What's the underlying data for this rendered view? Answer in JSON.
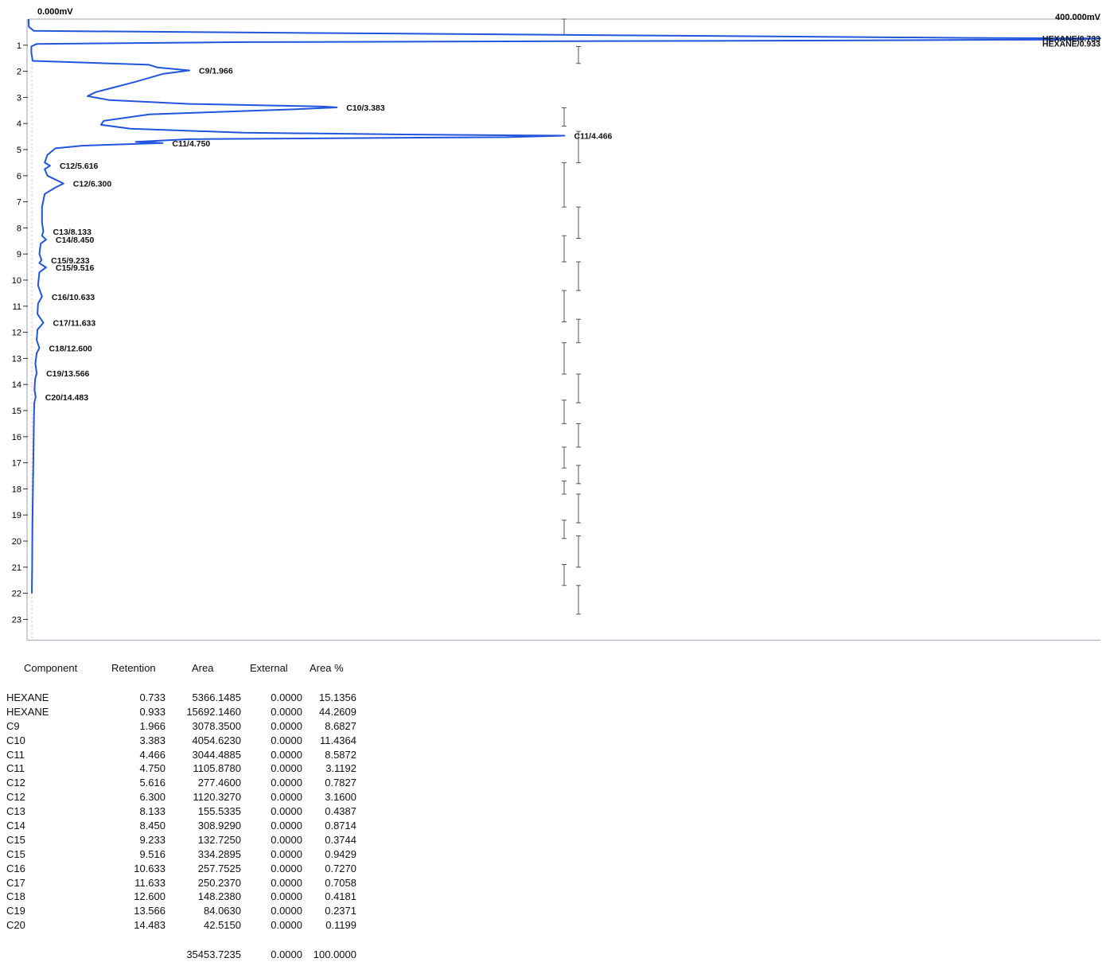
{
  "chart_data": {
    "type": "line",
    "title": "",
    "scale_min_label": "0.000mV",
    "scale_max_label": "400.000mV",
    "y_ticks": [
      "1",
      "2",
      "3",
      "4",
      "5",
      "6",
      "7",
      "8",
      "9",
      "10",
      "11",
      "12",
      "13",
      "14",
      "15",
      "16",
      "17",
      "18",
      "19",
      "20",
      "21",
      "22",
      "23"
    ],
    "ylim": [
      0,
      23.8
    ],
    "xlim": [
      0,
      400
    ],
    "orientation": "time-vertical",
    "series": [
      {
        "points": [
          [
            0,
            0.0
          ],
          [
            0,
            0.1
          ],
          [
            0.1,
            0.3
          ],
          [
            2,
            0.45
          ],
          [
            350,
            0.72
          ],
          [
            400,
            0.74
          ],
          [
            390,
            0.78
          ],
          [
            300,
            0.82
          ],
          [
            80,
            0.88
          ],
          [
            3,
            0.95
          ],
          [
            1,
            1.05
          ],
          [
            1,
            1.3
          ],
          [
            1.5,
            1.6
          ],
          [
            45,
            1.75
          ],
          [
            48,
            1.85
          ],
          [
            60,
            1.966
          ],
          [
            50,
            2.1
          ],
          [
            40,
            2.4
          ],
          [
            25,
            2.8
          ],
          [
            22,
            2.95
          ],
          [
            30,
            3.1
          ],
          [
            60,
            3.25
          ],
          [
            110,
            3.35
          ],
          [
            115,
            3.383
          ],
          [
            100,
            3.45
          ],
          [
            45,
            3.65
          ],
          [
            28,
            3.9
          ],
          [
            27,
            4.05
          ],
          [
            38,
            4.2
          ],
          [
            80,
            4.35
          ],
          [
            140,
            4.42
          ],
          [
            200,
            4.466
          ],
          [
            180,
            4.52
          ],
          [
            60,
            4.6
          ],
          [
            40,
            4.7
          ],
          [
            50,
            4.75
          ],
          [
            35,
            4.8
          ],
          [
            20,
            4.85
          ],
          [
            10,
            4.95
          ],
          [
            7,
            5.2
          ],
          [
            6,
            5.5
          ],
          [
            8,
            5.616
          ],
          [
            6,
            5.75
          ],
          [
            7,
            6.0
          ],
          [
            13,
            6.3
          ],
          [
            10,
            6.45
          ],
          [
            6,
            6.7
          ],
          [
            5,
            7.2
          ],
          [
            5,
            7.8
          ],
          [
            5.5,
            8.133
          ],
          [
            5,
            8.3
          ],
          [
            6.5,
            8.45
          ],
          [
            4.5,
            8.6
          ],
          [
            4,
            9.0
          ],
          [
            4.8,
            9.233
          ],
          [
            4,
            9.35
          ],
          [
            6.5,
            9.516
          ],
          [
            4,
            9.7
          ],
          [
            3.5,
            10.2
          ],
          [
            5,
            10.633
          ],
          [
            3.5,
            10.9
          ],
          [
            3.3,
            11.3
          ],
          [
            5.5,
            11.633
          ],
          [
            3.3,
            11.9
          ],
          [
            3,
            12.3
          ],
          [
            4,
            12.6
          ],
          [
            3,
            12.8
          ],
          [
            2.5,
            13.2
          ],
          [
            3,
            13.566
          ],
          [
            2.4,
            13.8
          ],
          [
            2.2,
            14.2
          ],
          [
            2.6,
            14.483
          ],
          [
            2.1,
            14.7
          ],
          [
            2,
            15.2
          ],
          [
            1.8,
            16.5
          ],
          [
            1.6,
            18.0
          ],
          [
            1.4,
            19.5
          ],
          [
            1.3,
            21.0
          ],
          [
            1.2,
            22.0
          ]
        ]
      }
    ],
    "peak_labels": [
      {
        "text": "HEXANE/0.733",
        "x": 400,
        "y": 0.733
      },
      {
        "text": "HEXANE/0.933",
        "x": 400,
        "y": 0.933
      },
      {
        "text": "C9/1.966",
        "x": 60,
        "y": 1.966
      },
      {
        "text": "C10/3.383",
        "x": 115,
        "y": 3.383
      },
      {
        "text": "C11/4.466",
        "x": 200,
        "y": 4.466
      },
      {
        "text": "C11/4.750",
        "x": 50,
        "y": 4.75
      },
      {
        "text": "C12/5.616",
        "x": 8,
        "y": 5.616
      },
      {
        "text": "C12/6.300",
        "x": 13,
        "y": 6.3
      },
      {
        "text": "C13/8.133",
        "x": 5.5,
        "y": 8.133
      },
      {
        "text": "C14/8.450",
        "x": 6.5,
        "y": 8.45
      },
      {
        "text": "C15/9.233",
        "x": 4.8,
        "y": 9.233
      },
      {
        "text": "C15/9.516",
        "x": 6.5,
        "y": 9.516
      },
      {
        "text": "C16/10.633",
        "x": 5,
        "y": 10.633
      },
      {
        "text": "C17/11.633",
        "x": 5.5,
        "y": 11.633
      },
      {
        "text": "C18/12.600",
        "x": 4,
        "y": 12.6
      },
      {
        "text": "C19/13.566",
        "x": 3,
        "y": 13.566
      },
      {
        "text": "C20/14.483",
        "x": 2.6,
        "y": 14.483
      }
    ],
    "events_col1": [
      [
        0.0,
        0.6
      ],
      [
        3.4,
        4.1
      ],
      [
        5.5,
        7.2
      ],
      [
        8.3,
        9.3
      ],
      [
        10.4,
        11.6
      ],
      [
        12.4,
        13.6
      ],
      [
        14.6,
        15.5
      ],
      [
        16.4,
        17.2
      ],
      [
        17.7,
        18.2
      ],
      [
        19.2,
        19.9
      ],
      [
        20.9,
        21.7
      ]
    ],
    "events_col2": [
      [
        1.05,
        1.7
      ],
      [
        4.3,
        5.5
      ],
      [
        7.2,
        8.4
      ],
      [
        9.3,
        10.4
      ],
      [
        11.5,
        12.4
      ],
      [
        13.6,
        14.7
      ],
      [
        15.5,
        16.4
      ],
      [
        17.1,
        17.8
      ],
      [
        18.2,
        19.3
      ],
      [
        19.8,
        21.0
      ],
      [
        21.7,
        22.8
      ]
    ]
  },
  "report": {
    "headers": {
      "component": "Component",
      "retention": "Retention",
      "area": "Area",
      "external": "External",
      "area_pct": "Area %"
    },
    "rows": [
      {
        "component": "HEXANE",
        "retention": "0.733",
        "area": "5366.1485",
        "external": "0.0000",
        "area_pct": "15.1356"
      },
      {
        "component": "HEXANE",
        "retention": "0.933",
        "area": "15692.1460",
        "external": "0.0000",
        "area_pct": "44.2609"
      },
      {
        "component": "C9",
        "retention": "1.966",
        "area": "3078.3500",
        "external": "0.0000",
        "area_pct": "8.6827"
      },
      {
        "component": "C10",
        "retention": "3.383",
        "area": "4054.6230",
        "external": "0.0000",
        "area_pct": "11.4364"
      },
      {
        "component": "C11",
        "retention": "4.466",
        "area": "3044.4885",
        "external": "0.0000",
        "area_pct": "8.5872"
      },
      {
        "component": "C11",
        "retention": "4.750",
        "area": "1105.8780",
        "external": "0.0000",
        "area_pct": "3.1192"
      },
      {
        "component": "C12",
        "retention": "5.616",
        "area": "277.4600",
        "external": "0.0000",
        "area_pct": "0.7827"
      },
      {
        "component": "C12",
        "retention": "6.300",
        "area": "1120.3270",
        "external": "0.0000",
        "area_pct": "3.1600"
      },
      {
        "component": "C13",
        "retention": "8.133",
        "area": "155.5335",
        "external": "0.0000",
        "area_pct": "0.4387"
      },
      {
        "component": "C14",
        "retention": "8.450",
        "area": "308.9290",
        "external": "0.0000",
        "area_pct": "0.8714"
      },
      {
        "component": "C15",
        "retention": "9.233",
        "area": "132.7250",
        "external": "0.0000",
        "area_pct": "0.3744"
      },
      {
        "component": "C15",
        "retention": "9.516",
        "area": "334.2895",
        "external": "0.0000",
        "area_pct": "0.9429"
      },
      {
        "component": "C16",
        "retention": "10.633",
        "area": "257.7525",
        "external": "0.0000",
        "area_pct": "0.7270"
      },
      {
        "component": "C17",
        "retention": "11.633",
        "area": "250.2370",
        "external": "0.0000",
        "area_pct": "0.7058"
      },
      {
        "component": "C18",
        "retention": "12.600",
        "area": "148.2380",
        "external": "0.0000",
        "area_pct": "0.4181"
      },
      {
        "component": "C19",
        "retention": "13.566",
        "area": "84.0630",
        "external": "0.0000",
        "area_pct": "0.2371"
      },
      {
        "component": "C20",
        "retention": "14.483",
        "area": "42.5150",
        "external": "0.0000",
        "area_pct": "0.1199"
      }
    ],
    "totals": {
      "area": "35453.7235",
      "external": "0.0000",
      "area_pct": "100.0000"
    }
  }
}
